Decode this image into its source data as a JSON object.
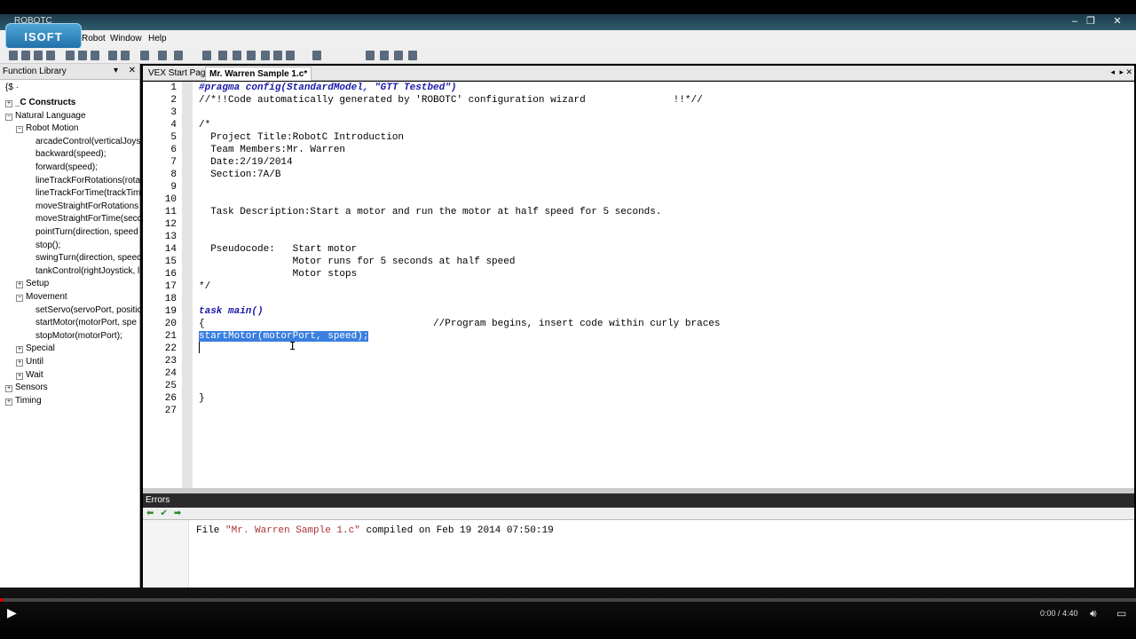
{
  "window": {
    "title": "ROBOTC",
    "controls": [
      "–",
      "❐",
      "✕"
    ]
  },
  "logo": {
    "text": "ISOFT"
  },
  "menubar": {
    "items": [
      "Robot",
      "Window",
      "Help"
    ]
  },
  "function_library": {
    "title": "Function Library",
    "filter": "{$ ·",
    "items": [
      {
        "label": "_C Constructs",
        "level": 0,
        "expander": "+",
        "bold": true
      },
      {
        "label": "Natural Language",
        "level": 0,
        "expander": "−"
      },
      {
        "label": "Robot Motion",
        "level": 1,
        "expander": "−"
      },
      {
        "label": "arcadeControl(verticalJoys",
        "level": 2
      },
      {
        "label": "backward(speed);",
        "level": 2
      },
      {
        "label": "forward(speed);",
        "level": 2
      },
      {
        "label": "lineTrackForRotations(rota",
        "level": 2
      },
      {
        "label": "lineTrackForTime(trackTim",
        "level": 2
      },
      {
        "label": "moveStraightForRotations",
        "level": 2
      },
      {
        "label": "moveStraightForTime(secc",
        "level": 2
      },
      {
        "label": "pointTurn(direction, speed",
        "level": 2
      },
      {
        "label": "stop();",
        "level": 2
      },
      {
        "label": "swingTurn(direction, speec",
        "level": 2
      },
      {
        "label": "tankControl(rightJoystick, l",
        "level": 2
      },
      {
        "label": "Setup",
        "level": 1,
        "expander": "+"
      },
      {
        "label": "Movement",
        "level": 1,
        "expander": "−"
      },
      {
        "label": "setServo(servoPort, positic",
        "level": 2
      },
      {
        "label": "startMotor(motorPort, spe",
        "level": 2
      },
      {
        "label": "stopMotor(motorPort);",
        "level": 2
      },
      {
        "label": "Special",
        "level": 1,
        "expander": "+"
      },
      {
        "label": "Until",
        "level": 1,
        "expander": "+"
      },
      {
        "label": "Wait",
        "level": 1,
        "expander": "+"
      },
      {
        "label": "Sensors",
        "level": 0,
        "expander": "+"
      },
      {
        "label": "Timing",
        "level": 0,
        "expander": "+"
      }
    ]
  },
  "tabs": [
    {
      "label": "VEX Start Page",
      "active": false
    },
    {
      "label": "Mr. Warren Sample 1.c*",
      "active": true
    }
  ],
  "editor": {
    "lines": [
      {
        "n": "1",
        "text": "#pragma config(StandardModel, \"GTT Testbed\")"
      },
      {
        "n": "2",
        "text": "//*!!Code automatically generated by 'ROBOTC' configuration wizard               !!*//"
      },
      {
        "n": "3",
        "text": ""
      },
      {
        "n": "4",
        "text": "/*"
      },
      {
        "n": "5",
        "text": "  Project Title:RobotC Introduction"
      },
      {
        "n": "6",
        "text": "  Team Members:Mr. Warren"
      },
      {
        "n": "7",
        "text": "  Date:2/19/2014"
      },
      {
        "n": "8",
        "text": "  Section:7A/B"
      },
      {
        "n": "9",
        "text": ""
      },
      {
        "n": "10",
        "text": ""
      },
      {
        "n": "11",
        "text": "  Task Description:Start a motor and run the motor at half speed for 5 seconds."
      },
      {
        "n": "12",
        "text": ""
      },
      {
        "n": "13",
        "text": ""
      },
      {
        "n": "14",
        "text": "  Pseudocode:   Start motor"
      },
      {
        "n": "15",
        "text": "                Motor runs for 5 seconds at half speed"
      },
      {
        "n": "16",
        "text": "                Motor stops"
      },
      {
        "n": "17",
        "text": "*/"
      },
      {
        "n": "18",
        "text": ""
      },
      {
        "n": "19",
        "text": "task main()"
      },
      {
        "n": "20",
        "text": "{                                       //Program begins, insert code within curly braces"
      },
      {
        "n": "21",
        "text": "startMotor(motorPort, speed);"
      },
      {
        "n": "22",
        "text": ""
      },
      {
        "n": "23",
        "text": ""
      },
      {
        "n": "24",
        "text": ""
      },
      {
        "n": "25",
        "text": ""
      },
      {
        "n": "26",
        "text": "}"
      },
      {
        "n": "27",
        "text": ""
      }
    ]
  },
  "errors_panel": {
    "title": "Errors",
    "message_prefix": "File ",
    "message_file": "\"Mr. Warren Sample 1.c\"",
    "message_suffix": " compiled on Feb 19 2014 07:50:19"
  },
  "player": {
    "time": "0:00 / 4:40",
    "progress": 0.0
  }
}
